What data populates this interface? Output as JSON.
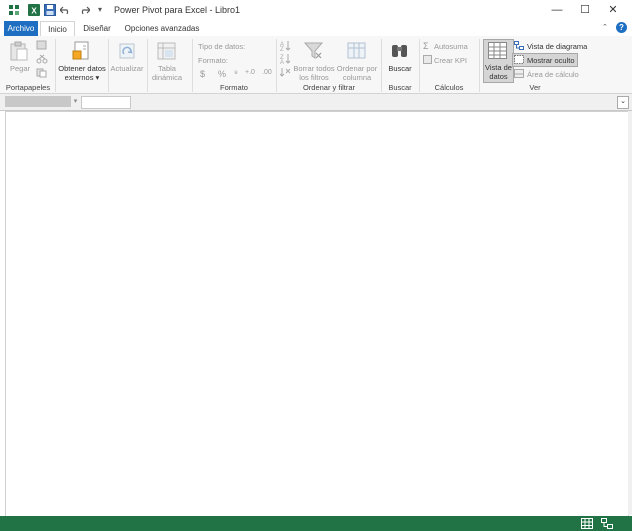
{
  "window": {
    "title": "Power Pivot para Excel - Libro1",
    "minimize": "—",
    "maximize": "☐",
    "close": "✕"
  },
  "tabs": [
    {
      "label": "Archivo"
    },
    {
      "label": "Inicio"
    },
    {
      "label": "Diseñar"
    },
    {
      "label": "Opciones avanzadas"
    }
  ],
  "help": "?",
  "ribbon": {
    "portapapeles": {
      "label": "Portapapeles",
      "paste": "Pegar"
    },
    "obtener": {
      "label": "Obtener datos externos",
      "line1": "Obtener datos",
      "line2": "externos"
    },
    "actualizar": {
      "label": "Actualizar"
    },
    "tabla": {
      "line1": "Tabla",
      "line2": "dinámica"
    },
    "formato": {
      "label": "Formato",
      "tipo": "Tipo de datos:",
      "formato": "Formato:",
      "dollar": "$",
      "percent": "%",
      "comma": "⁹",
      "inc": "+.0",
      "dec": ".00"
    },
    "ordenar": {
      "label": "Ordenar y filtrar",
      "clear_line1": "Borrar todos",
      "clear_line2": "los filtros",
      "sort_line1": "Ordenar por",
      "sort_line2": "columna"
    },
    "buscar": {
      "label": "Buscar",
      "button": "Buscar"
    },
    "calculos": {
      "label": "Cálculos",
      "autosuma": "Autosuma",
      "kpi": "Crear KPI"
    },
    "ver": {
      "label": "Ver",
      "vista_line1": "Vista de",
      "vista_line2": "datos",
      "diagrama": "Vista de diagrama",
      "oculto": "Mostrar oculto",
      "area": "Área de cálculo"
    }
  },
  "formula_bar": {
    "dropdown": "▾",
    "expand": "⌄"
  },
  "colors": {
    "file_tab": "#1e6fc1",
    "status_bar": "#217346",
    "excel_green": "#217346"
  }
}
